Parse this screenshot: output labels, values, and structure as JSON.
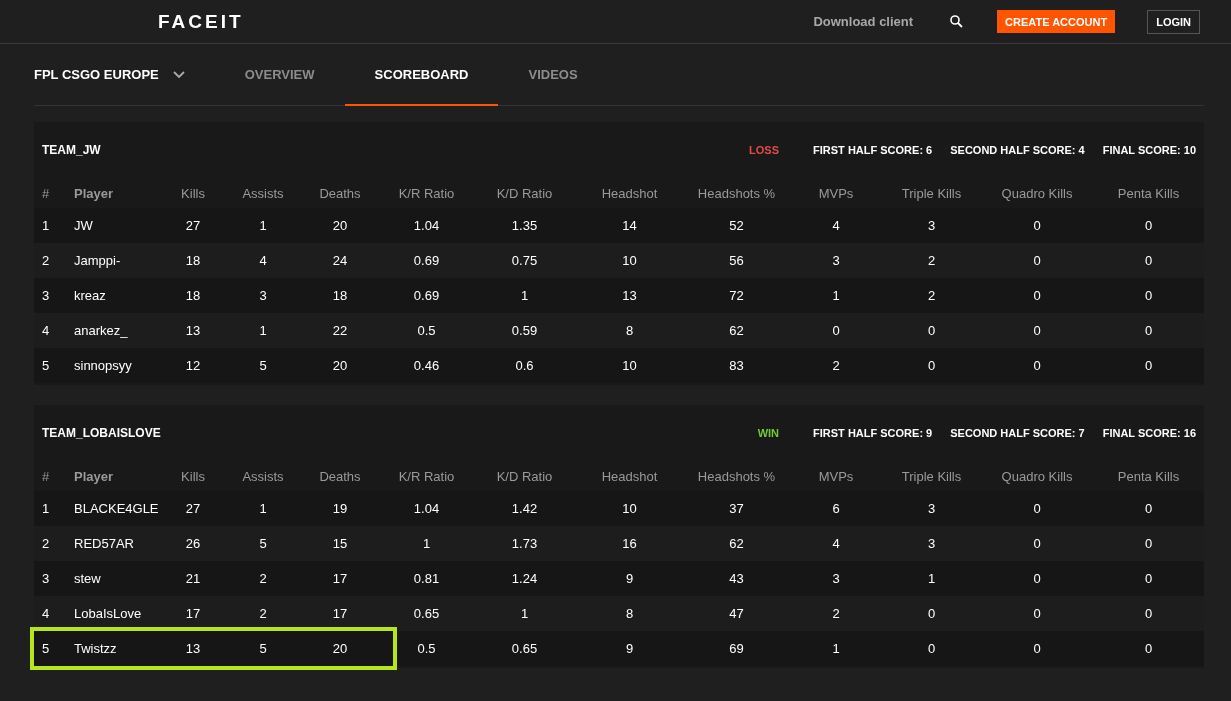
{
  "header": {
    "logo": "FACEIT",
    "download": "Download client",
    "create_account": "CREATE ACCOUNT",
    "login": "LOGIN"
  },
  "nav": {
    "competition": "FPL CSGO EUROPE",
    "tabs": [
      {
        "label": "OVERVIEW",
        "selected": false
      },
      {
        "label": "SCOREBOARD",
        "selected": true
      },
      {
        "label": "VIDEOS",
        "selected": false
      }
    ]
  },
  "teams": [
    {
      "name": "TEAM_JW",
      "result": {
        "kind": "loss",
        "label": "LOSS"
      },
      "scores": [
        "FIRST HALF SCORE: 6",
        "SECOND HALF SCORE: 4",
        "FINAL SCORE: 10"
      ],
      "columns": [
        "#",
        "Player",
        "Kills",
        "Assists",
        "Deaths",
        "K/R Ratio",
        "K/D Ratio",
        "Headshot",
        "Headshots %",
        "MVPs",
        "Triple Kills",
        "Quadro Kills",
        "Penta Kills"
      ],
      "rows": [
        {
          "cells": [
            "1",
            "JW",
            "27",
            "1",
            "20",
            "1.04",
            "1.35",
            "14",
            "52",
            "4",
            "3",
            "0",
            "0"
          ],
          "highlighted": false
        },
        {
          "cells": [
            "2",
            "Jamppi-",
            "18",
            "4",
            "24",
            "0.69",
            "0.75",
            "10",
            "56",
            "3",
            "2",
            "0",
            "0"
          ],
          "highlighted": false
        },
        {
          "cells": [
            "3",
            "kreaz",
            "18",
            "3",
            "18",
            "0.69",
            "1",
            "13",
            "72",
            "1",
            "2",
            "0",
            "0"
          ],
          "highlighted": false
        },
        {
          "cells": [
            "4",
            "anarkez_",
            "13",
            "1",
            "22",
            "0.5",
            "0.59",
            "8",
            "62",
            "0",
            "0",
            "0",
            "0"
          ],
          "highlighted": false
        },
        {
          "cells": [
            "5",
            "sinnopsyy",
            "12",
            "5",
            "20",
            "0.46",
            "0.6",
            "10",
            "83",
            "2",
            "0",
            "0",
            "0"
          ],
          "highlighted": false
        }
      ]
    },
    {
      "name": "TEAM_LOBAISLOVE",
      "result": {
        "kind": "win",
        "label": "WIN"
      },
      "scores": [
        "FIRST HALF SCORE: 9",
        "SECOND HALF SCORE: 7",
        "FINAL SCORE: 16"
      ],
      "columns": [
        "#",
        "Player",
        "Kills",
        "Assists",
        "Deaths",
        "K/R Ratio",
        "K/D Ratio",
        "Headshot",
        "Headshots %",
        "MVPs",
        "Triple Kills",
        "Quadro Kills",
        "Penta Kills"
      ],
      "rows": [
        {
          "cells": [
            "1",
            "BLACKE4GLE",
            "27",
            "1",
            "19",
            "1.04",
            "1.42",
            "10",
            "37",
            "6",
            "3",
            "0",
            "0"
          ],
          "highlighted": false
        },
        {
          "cells": [
            "2",
            "RED57AR",
            "26",
            "5",
            "15",
            "1",
            "1.73",
            "16",
            "62",
            "4",
            "3",
            "0",
            "0"
          ],
          "highlighted": false
        },
        {
          "cells": [
            "3",
            "stew",
            "21",
            "2",
            "17",
            "0.81",
            "1.24",
            "9",
            "43",
            "3",
            "1",
            "0",
            "0"
          ],
          "highlighted": false
        },
        {
          "cells": [
            "4",
            "LobaIsLove",
            "17",
            "2",
            "17",
            "0.65",
            "1",
            "8",
            "47",
            "2",
            "0",
            "0",
            "0"
          ],
          "highlighted": false
        },
        {
          "cells": [
            "5",
            "Twistzz",
            "13",
            "5",
            "20",
            "0.5",
            "0.65",
            "9",
            "69",
            "1",
            "0",
            "0",
            "0"
          ],
          "highlighted": true
        }
      ]
    }
  ]
}
